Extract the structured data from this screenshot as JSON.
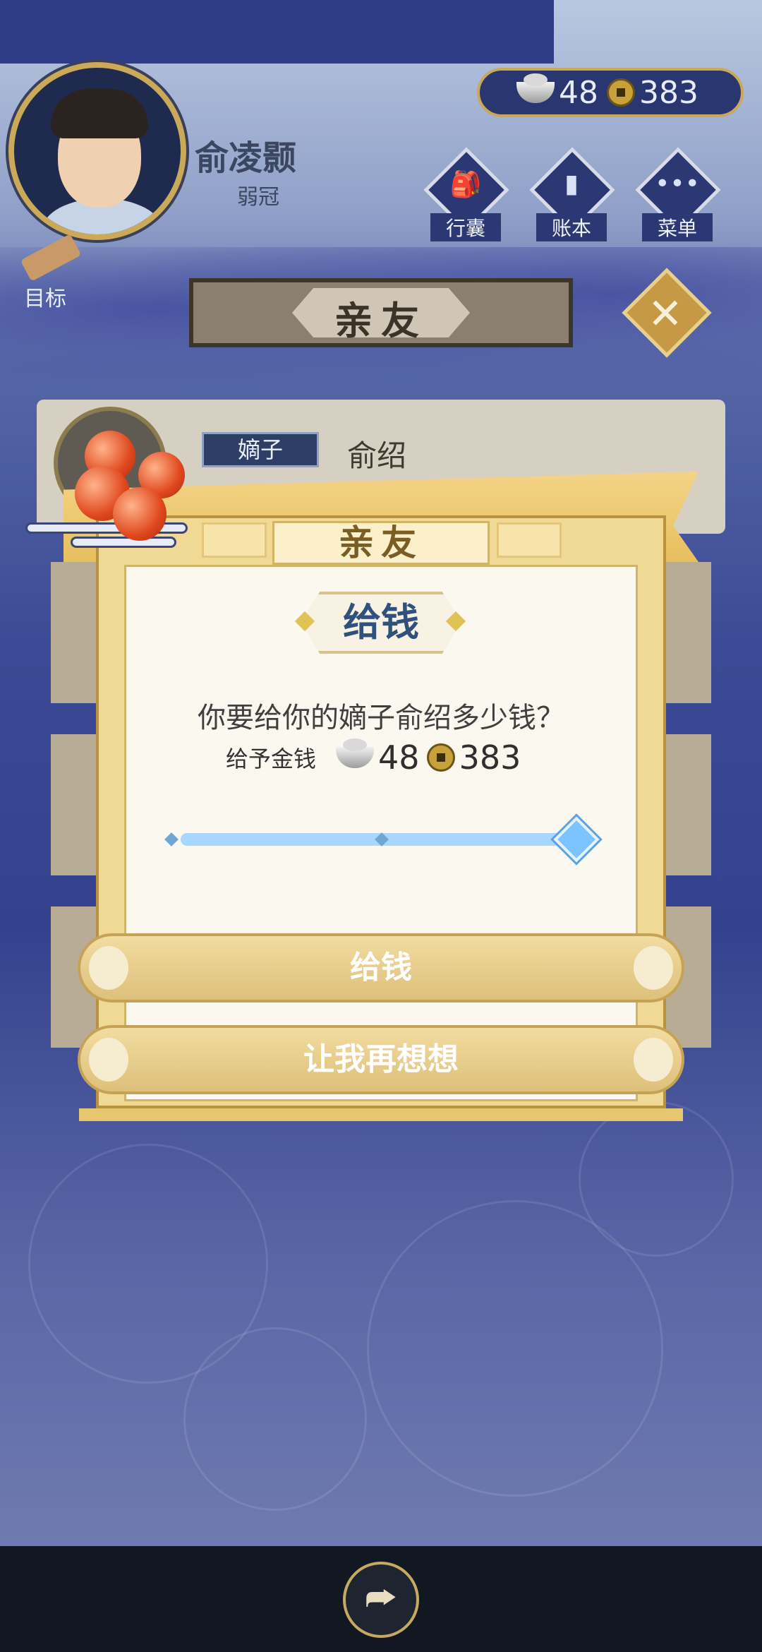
{
  "player": {
    "name": "俞凌颢",
    "title": "弱冠"
  },
  "currency": {
    "silver": "48",
    "copper": "383",
    "silver_icon": "silver-ingot-icon",
    "copper_icon": "copper-coin-icon"
  },
  "menu": {
    "bag": "行囊",
    "ledger": "账本",
    "menu": "菜单",
    "goal": "目标"
  },
  "screen_title": "亲友",
  "close_label": "✕",
  "friend": {
    "relation": "嫡子",
    "name": "俞绍"
  },
  "dialog": {
    "header": "亲友",
    "action_title": "给钱",
    "question": "你要给你的嫡子俞绍多少钱？",
    "amount_label": "给予金钱",
    "amount_silver": "48",
    "amount_copper": "383",
    "slider_value": 1.0,
    "confirm_label": "给钱",
    "cancel_label": "让我再想想"
  },
  "bottom": {
    "share_icon": "share-icon",
    "share_glyph": "⮫"
  },
  "colors": {
    "accent_gold": "#e7bf5f",
    "title_blue": "#30517e",
    "slider_blue": "#7cc4ff"
  }
}
